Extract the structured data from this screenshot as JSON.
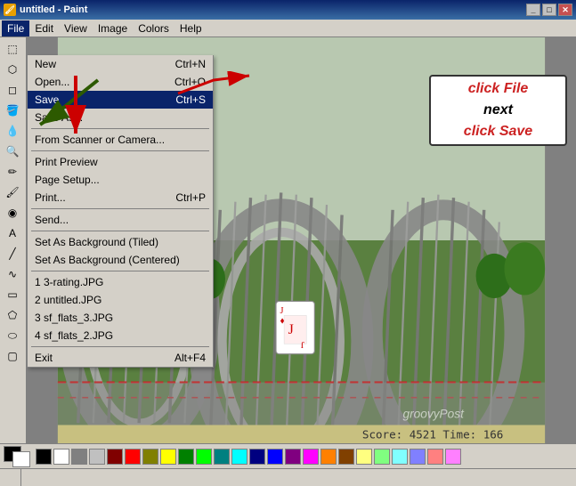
{
  "titleBar": {
    "title": "untitled - Paint",
    "icon": "🎨"
  },
  "menuBar": {
    "items": [
      "File",
      "Edit",
      "View",
      "Image",
      "Colors",
      "Help"
    ]
  },
  "fileMenu": {
    "items": [
      {
        "label": "New",
        "shortcut": "Ctrl+N",
        "disabled": false
      },
      {
        "label": "Open...",
        "shortcut": "Ctrl+O",
        "disabled": false
      },
      {
        "label": "Save",
        "shortcut": "Ctrl+S",
        "highlighted": true,
        "disabled": false
      },
      {
        "label": "Save As...",
        "shortcut": "",
        "disabled": false
      },
      {
        "separator": true
      },
      {
        "label": "From Scanner or Camera...",
        "shortcut": "",
        "disabled": false
      },
      {
        "separator": true
      },
      {
        "label": "Print Preview",
        "shortcut": "",
        "disabled": false
      },
      {
        "label": "Page Setup...",
        "shortcut": "",
        "disabled": false
      },
      {
        "label": "Print...",
        "shortcut": "Ctrl+P",
        "disabled": false
      },
      {
        "separator": true
      },
      {
        "label": "Send...",
        "shortcut": "",
        "disabled": false
      },
      {
        "separator": true
      },
      {
        "label": "Set As Background (Tiled)",
        "shortcut": "",
        "disabled": false
      },
      {
        "label": "Set As Background (Centered)",
        "shortcut": "",
        "disabled": false
      },
      {
        "separator": true
      },
      {
        "label": "1 3-rating.JPG",
        "shortcut": "",
        "disabled": false
      },
      {
        "label": "2 untitled.JPG",
        "shortcut": "",
        "disabled": false
      },
      {
        "label": "3 sf_flats_3.JPG",
        "shortcut": "",
        "disabled": false
      },
      {
        "label": "4 sf_flats_2.JPG",
        "shortcut": "",
        "disabled": false
      },
      {
        "separator": true
      },
      {
        "label": "Exit",
        "shortcut": "Alt+F4",
        "disabled": false
      }
    ]
  },
  "annotation": {
    "line1": "click File",
    "line2": "next",
    "line3": "click Save"
  },
  "scoreBar": {
    "text": "Score: 4521  Time: 166"
  },
  "statusBar": {
    "text": ""
  },
  "colors": {
    "label": "Colors",
    "palette": [
      "#000000",
      "#808080",
      "#800000",
      "#808000",
      "#008000",
      "#008080",
      "#000080",
      "#800080",
      "#ffffff",
      "#c0c0c0",
      "#ff0000",
      "#ffff00",
      "#00ff00",
      "#00ffff",
      "#0000ff",
      "#ff00ff",
      "#ffff80",
      "#80ff80",
      "#80ffff",
      "#8080ff",
      "#ff8080",
      "#ff80ff",
      "#ff8000",
      "#804000"
    ]
  }
}
